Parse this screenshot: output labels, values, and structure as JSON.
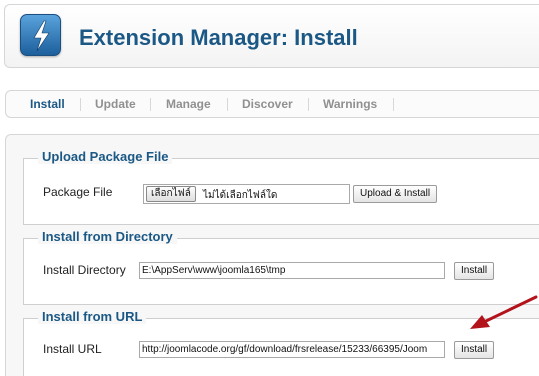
{
  "header": {
    "title": "Extension Manager: Install",
    "icon": "bolt-icon"
  },
  "tabs": [
    "Install",
    "Update",
    "Manage",
    "Discover",
    "Warnings"
  ],
  "active_tab": "Install",
  "upload": {
    "legend": "Upload Package File",
    "label": "Package File",
    "choose_label": "เลือกไฟล์",
    "no_file_label": "ไม่ได้เลือกไฟล์ใด",
    "button": "Upload & Install"
  },
  "directory": {
    "legend": "Install from Directory",
    "label": "Install Directory",
    "value": "E:\\AppServ\\www\\joomla165\\tmp",
    "button": "Install"
  },
  "url": {
    "legend": "Install from URL",
    "label": "Install URL",
    "value": "http://joomlacode.org/gf/download/frsrelease/15233/66395/Joom",
    "button": "Install"
  },
  "colors": {
    "accent": "#1b5885",
    "arrow": "#b3141c"
  }
}
